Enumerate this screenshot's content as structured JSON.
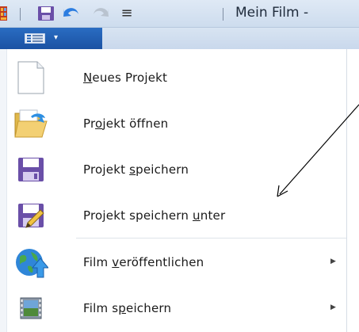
{
  "window": {
    "title": "Mein Film - "
  },
  "qat": {
    "app_icon": "app-icon",
    "save_icon": "save-icon",
    "undo_icon": "undo-icon",
    "redo_icon": "redo-icon",
    "customize_icon": "customize-qat-icon",
    "customize_glyph": "≡"
  },
  "file_tab": {
    "icon": "file-menu-icon",
    "arrow": "▾"
  },
  "menu": {
    "items": [
      {
        "label_pre": "",
        "label_u": "N",
        "label_post": "eues Projekt",
        "icon": "new-project-icon",
        "has_submenu": false
      },
      {
        "label_pre": "Pr",
        "label_u": "o",
        "label_post": "jekt öffnen",
        "icon": "open-project-icon",
        "has_submenu": false
      },
      {
        "label_pre": "Projekt ",
        "label_u": "s",
        "label_post": "peichern",
        "icon": "save-project-icon",
        "has_submenu": false
      },
      {
        "label_pre": "Projekt speichern ",
        "label_u": "u",
        "label_post": "nter",
        "icon": "save-project-as-icon",
        "has_submenu": false
      },
      {
        "label_pre": "Film ",
        "label_u": "v",
        "label_post": "eröffentlichen",
        "icon": "publish-film-icon",
        "has_submenu": true,
        "arrow": "▶"
      },
      {
        "label_pre": "Film s",
        "label_u": "p",
        "label_post": "eichern",
        "icon": "save-film-icon",
        "has_submenu": true,
        "arrow": "▶"
      }
    ]
  },
  "colors": {
    "file_tab": "#1f5fb3",
    "annotation_arrow": "#000000"
  }
}
